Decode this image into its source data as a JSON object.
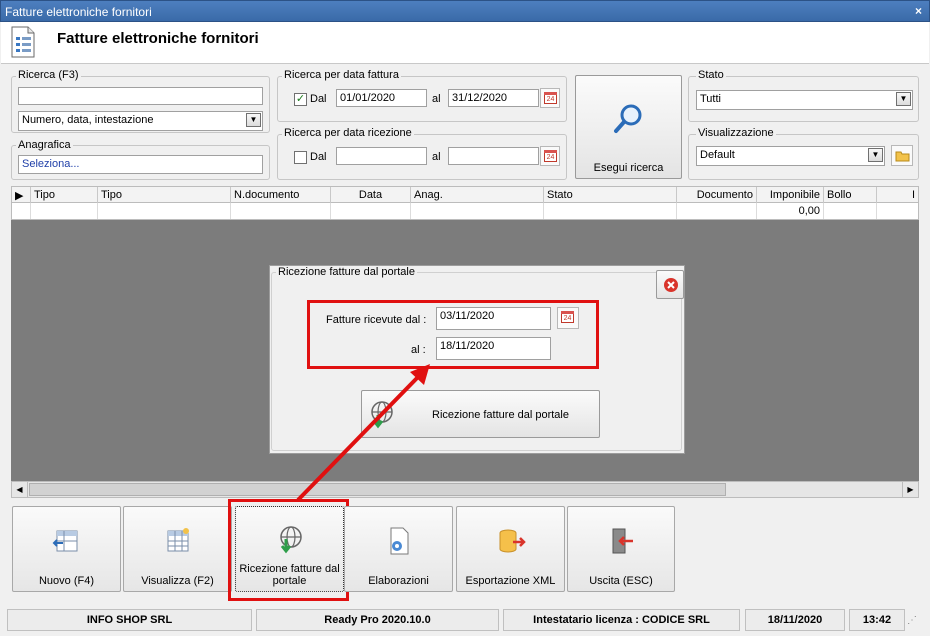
{
  "window": {
    "title": "Fatture elettroniche fornitori",
    "close_glyph": "×"
  },
  "header": {
    "title": "Fatture elettroniche fornitori"
  },
  "ricerca": {
    "label": "Ricerca (F3)",
    "value": "",
    "mode": "Numero, data, intestazione"
  },
  "anagrafica": {
    "label": "Anagrafica",
    "value": "Seleziona..."
  },
  "data_fattura": {
    "label": "Ricerca per data fattura",
    "dal_label": "Dal",
    "dal_checked": true,
    "dal_value": "01/01/2020",
    "al_label": "al",
    "al_value": "31/12/2020"
  },
  "data_ricezione": {
    "label": "Ricerca per data ricezione",
    "dal_label": "Dal",
    "dal_checked": false,
    "dal_value": "",
    "al_label": "al",
    "al_value": ""
  },
  "calendar_day": "24",
  "esegui": {
    "label": "Esegui ricerca"
  },
  "stato": {
    "label": "Stato",
    "value": "Tutti"
  },
  "visualizzazione": {
    "label": "Visualizzazione",
    "value": "Default"
  },
  "grid": {
    "columns": [
      "Tipo",
      "Tipo",
      "N.documento",
      "Data",
      "Anag.",
      "Stato",
      "Documento",
      "Imponibile",
      "Bollo",
      "I"
    ],
    "row": [
      "",
      "",
      "",
      "",
      "",
      "",
      "",
      "0,00",
      "",
      ""
    ]
  },
  "dialog": {
    "title": "Ricezione fatture dal portale",
    "dal_label": "Fatture ricevute dal :",
    "dal_value": "03/11/2020",
    "al_label": "al :",
    "al_value": "18/11/2020",
    "button_label": "Ricezione fatture dal portale"
  },
  "toolbar": [
    {
      "name": "nuovo",
      "label": "Nuovo (F4)"
    },
    {
      "name": "visualizza",
      "label": "Visualizza (F2)"
    },
    {
      "name": "ricezione",
      "label": "Ricezione fatture dal portale"
    },
    {
      "name": "elaborazioni",
      "label": "Elaborazioni"
    },
    {
      "name": "esportazione",
      "label": "Esportazione XML"
    },
    {
      "name": "uscita",
      "label": "Uscita (ESC)"
    }
  ],
  "statusbar": {
    "company": "INFO SHOP SRL",
    "product": "Ready Pro 2020.10.0",
    "licensee": "Intestatario licenza : CODICE SRL",
    "date": "18/11/2020",
    "time": "13:42"
  },
  "colors": {
    "highlight_red": "#e01010",
    "accent_blue": "#3a6aa8",
    "grid_background": "#7c7c7c"
  }
}
